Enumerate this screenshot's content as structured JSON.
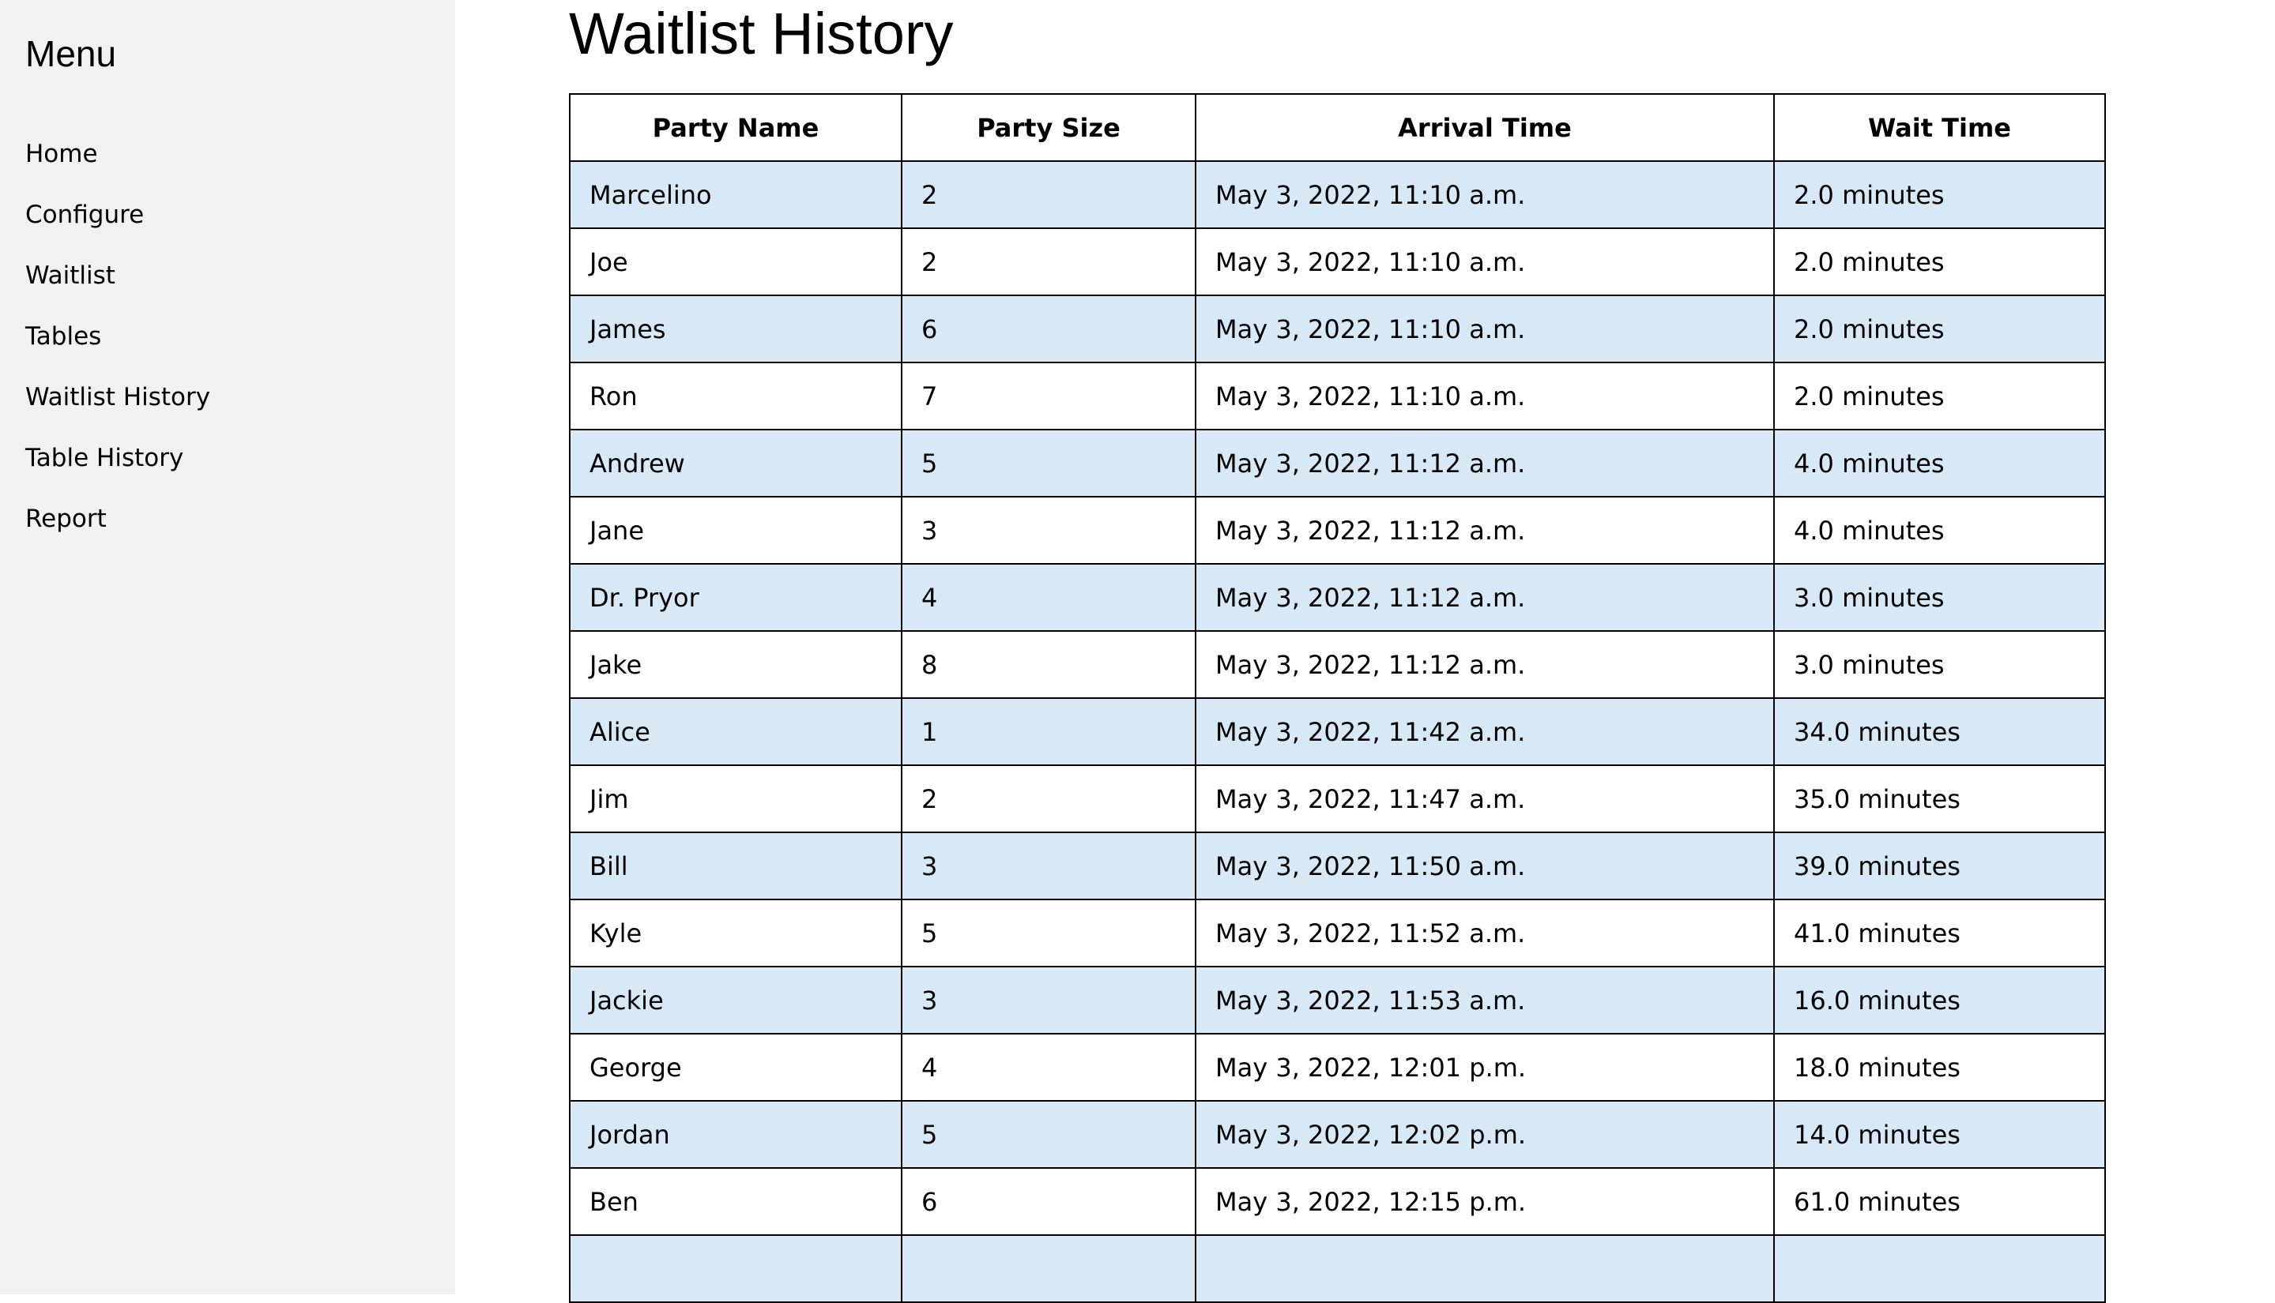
{
  "sidebar": {
    "title": "Menu",
    "items": [
      {
        "label": "Home"
      },
      {
        "label": "Configure"
      },
      {
        "label": "Waitlist"
      },
      {
        "label": "Tables"
      },
      {
        "label": "Waitlist History"
      },
      {
        "label": "Table History"
      },
      {
        "label": "Report"
      }
    ]
  },
  "main": {
    "title": "Waitlist History",
    "table": {
      "headers": [
        "Party Name",
        "Party Size",
        "Arrival Time",
        "Wait Time"
      ],
      "rows": [
        [
          "Marcelino",
          "2",
          "May 3, 2022, 11:10 a.m.",
          "2.0 minutes"
        ],
        [
          "Joe",
          "2",
          "May 3, 2022, 11:10 a.m.",
          "2.0 minutes"
        ],
        [
          "James",
          "6",
          "May 3, 2022, 11:10 a.m.",
          "2.0 minutes"
        ],
        [
          "Ron",
          "7",
          "May 3, 2022, 11:10 a.m.",
          "2.0 minutes"
        ],
        [
          "Andrew",
          "5",
          "May 3, 2022, 11:12 a.m.",
          "4.0 minutes"
        ],
        [
          "Jane",
          "3",
          "May 3, 2022, 11:12 a.m.",
          "4.0 minutes"
        ],
        [
          "Dr. Pryor",
          "4",
          "May 3, 2022, 11:12 a.m.",
          "3.0 minutes"
        ],
        [
          "Jake",
          "8",
          "May 3, 2022, 11:12 a.m.",
          "3.0 minutes"
        ],
        [
          "Alice",
          "1",
          "May 3, 2022, 11:42 a.m.",
          "34.0 minutes"
        ],
        [
          "Jim",
          "2",
          "May 3, 2022, 11:47 a.m.",
          "35.0 minutes"
        ],
        [
          "Bill",
          "3",
          "May 3, 2022, 11:50 a.m.",
          "39.0 minutes"
        ],
        [
          "Kyle",
          "5",
          "May 3, 2022, 11:52 a.m.",
          "41.0 minutes"
        ],
        [
          "Jackie",
          "3",
          "May 3, 2022, 11:53 a.m.",
          "16.0 minutes"
        ],
        [
          "George",
          "4",
          "May 3, 2022, 12:01 p.m.",
          "18.0 minutes"
        ],
        [
          "Jordan",
          "5",
          "May 3, 2022, 12:02 p.m.",
          "14.0 minutes"
        ],
        [
          "Ben",
          "6",
          "May 3, 2022, 12:15 p.m.",
          "61.0 minutes"
        ],
        [
          "",
          "",
          "",
          ""
        ]
      ]
    }
  },
  "colors": {
    "sidebar_bg": "#f1f1f1",
    "row_stripe": "#d7e9f7",
    "border": "#000000"
  }
}
